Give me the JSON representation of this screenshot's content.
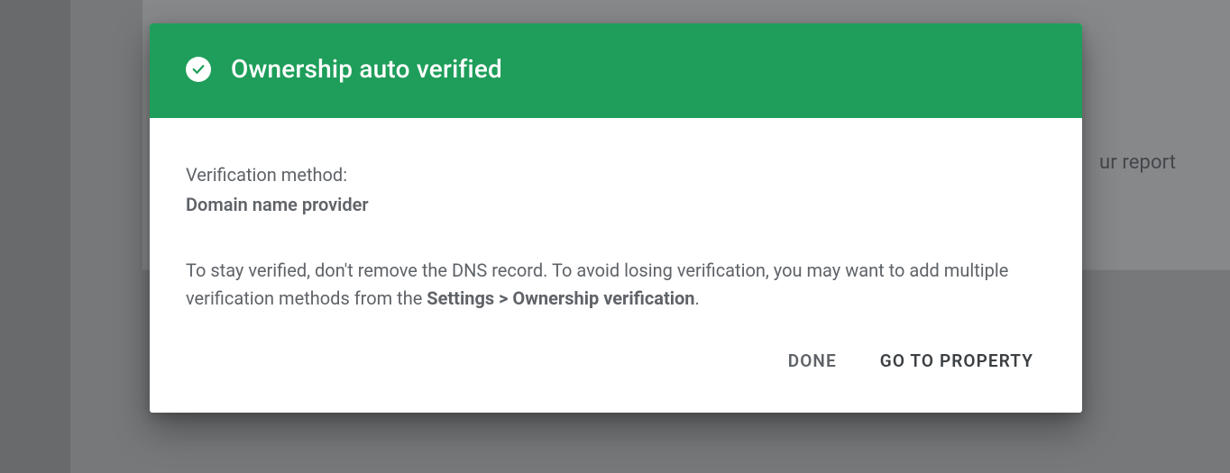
{
  "background": {
    "partial_text": "ur report"
  },
  "dialog": {
    "title": "Ownership auto verified",
    "method_label": "Verification method:",
    "method_value": "Domain name provider",
    "body_before": "To stay verified, don't remove the DNS record. To avoid losing verification, you may want to add multiple verification methods from the ",
    "body_strong": "Settings > Ownership verification",
    "body_after": ".",
    "actions": {
      "done": "DONE",
      "go_to_property": "GO TO PROPERTY"
    }
  }
}
